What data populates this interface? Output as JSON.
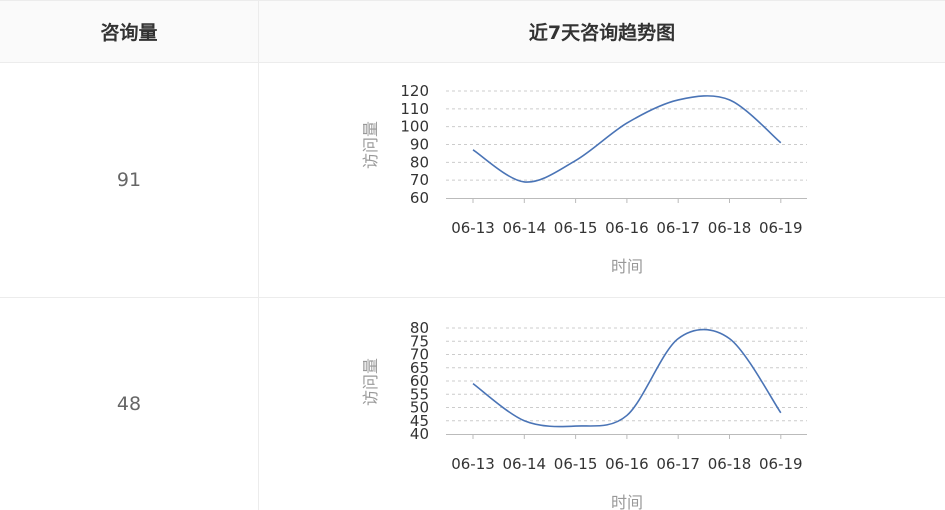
{
  "table": {
    "headers": [
      "咨询量",
      "近7天咨询趋势图"
    ],
    "rows": [
      {
        "count": "91"
      },
      {
        "count": "48"
      }
    ]
  },
  "chart_data": [
    {
      "type": "line",
      "x": [
        "06-13",
        "06-14",
        "06-15",
        "06-16",
        "06-17",
        "06-18",
        "06-19"
      ],
      "series": [
        {
          "values": [
            87,
            69,
            81,
            102,
            115,
            115,
            91
          ]
        }
      ],
      "xlabel": "时间",
      "ylabel": "访问量",
      "ylim": [
        60,
        120
      ],
      "yticks": [
        "60",
        "70",
        "80",
        "90",
        "100",
        "110",
        "120"
      ],
      "ystep": 10,
      "line_color": "#4a74b6",
      "grid": true
    },
    {
      "type": "line",
      "x": [
        "06-13",
        "06-14",
        "06-15",
        "06-16",
        "06-17",
        "06-18",
        "06-19"
      ],
      "series": [
        {
          "values": [
            59,
            45,
            43,
            47,
            76,
            76,
            48
          ]
        }
      ],
      "xlabel": "时间",
      "ylabel": "访问量",
      "ylim": [
        40,
        80
      ],
      "yticks": [
        "40",
        "45",
        "50",
        "55",
        "60",
        "65",
        "70",
        "75",
        "80"
      ],
      "ystep": 5,
      "line_color": "#4a74b6",
      "grid": true
    }
  ]
}
